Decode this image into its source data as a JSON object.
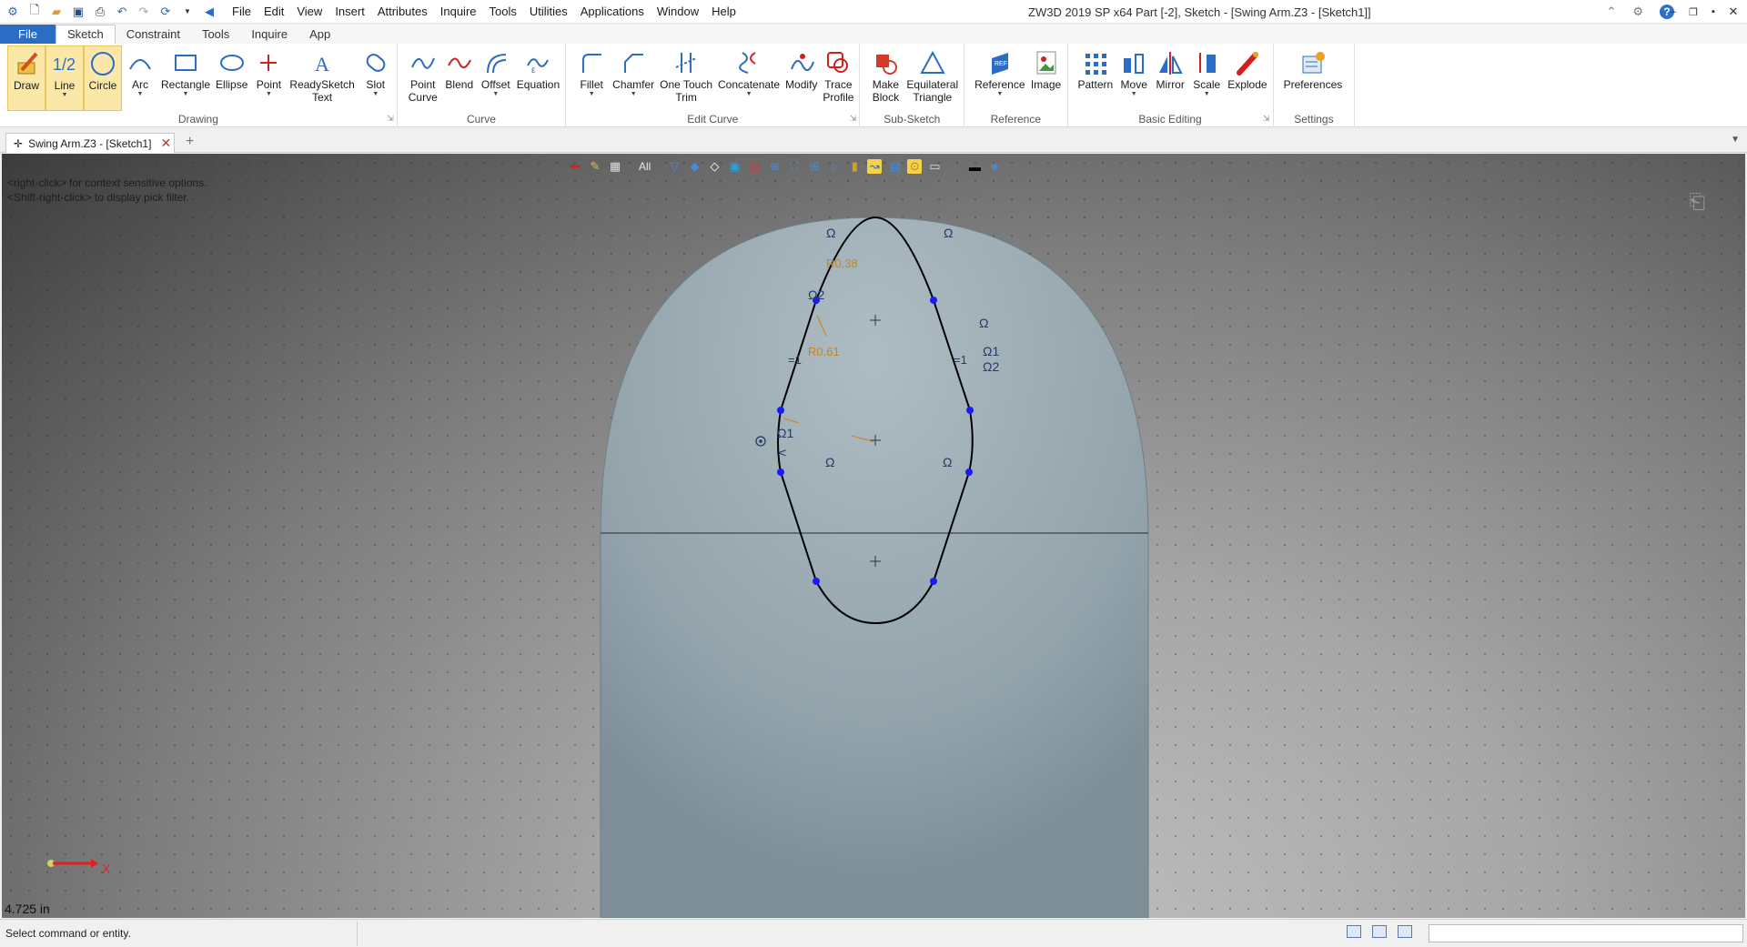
{
  "app": {
    "title": "ZW3D 2019 SP x64",
    "document_title": "Part [-2],  Sketch - [Swing Arm.Z3 - [Sketch1]]"
  },
  "quick_access": [
    "app-logo-icon",
    "new-file-icon",
    "open-file-icon",
    "save-icon",
    "print-icon",
    "undo-icon",
    "redo-icon",
    "cycle-icon",
    "dropdown-icon",
    "back-arrow-icon"
  ],
  "menubar": {
    "items": [
      "File",
      "Edit",
      "View",
      "Insert",
      "Attributes",
      "Inquire",
      "Tools",
      "Utilities",
      "Applications",
      "Window",
      "Help"
    ]
  },
  "ribbon_tabs": {
    "file": "File",
    "tabs": [
      "Sketch",
      "Constraint",
      "Tools",
      "Inquire",
      "App"
    ],
    "active": "Sketch"
  },
  "ribbon": {
    "groups": [
      {
        "title": "Drawing",
        "buttons": [
          {
            "label": "Draw",
            "icon": "pencil-icon",
            "selected": true
          },
          {
            "label": "Line",
            "icon": "line-icon",
            "selected": true,
            "dropdown": true
          },
          {
            "label": "Circle",
            "icon": "circle-icon",
            "selected": true
          },
          {
            "label": "Arc",
            "icon": "arc-icon",
            "dropdown": true
          },
          {
            "label": "Rectangle",
            "icon": "rectangle-icon",
            "dropdown": true
          },
          {
            "label": "Ellipse",
            "icon": "ellipse-icon"
          },
          {
            "label": "Point",
            "icon": "point-icon",
            "dropdown": true
          },
          {
            "label": "ReadySketch",
            "label2": "Text",
            "icon": "text-icon",
            "dropdown": true
          },
          {
            "label": "Slot",
            "icon": "slot-icon",
            "dropdown": true
          }
        ]
      },
      {
        "title": "Curve",
        "buttons": [
          {
            "label": "Point",
            "label2": "Curve",
            "icon": "point-curve-icon",
            "dropdown": true
          },
          {
            "label": "Blend",
            "icon": "blend-icon"
          },
          {
            "label": "Offset",
            "icon": "offset-icon",
            "dropdown": true
          },
          {
            "label": "Equation",
            "icon": "equation-icon"
          }
        ]
      },
      {
        "title": "Edit Curve",
        "buttons": [
          {
            "label": "Fillet",
            "icon": "fillet-icon",
            "dropdown": true
          },
          {
            "label": "Chamfer",
            "icon": "chamfer-icon",
            "dropdown": true
          },
          {
            "label": "One Touch",
            "label2": "Trim",
            "icon": "trim-icon",
            "dropdown": true
          },
          {
            "label": "Concatenate",
            "icon": "concatenate-icon",
            "dropdown": true
          },
          {
            "label": "Modify",
            "icon": "modify-icon"
          },
          {
            "label": "Trace",
            "label2": "Profile",
            "icon": "trace-profile-icon",
            "dropdown": true
          }
        ]
      },
      {
        "title": "Sub-Sketch",
        "buttons": [
          {
            "label": "Make",
            "label2": "Block",
            "icon": "make-block-icon",
            "dropdown": true
          },
          {
            "label": "Equilateral",
            "label2": "Triangle",
            "icon": "triangle-icon",
            "dropdown": true
          }
        ]
      },
      {
        "title": "Reference",
        "buttons": [
          {
            "label": "Reference",
            "icon": "reference-icon",
            "dropdown": true
          },
          {
            "label": "Image",
            "icon": "image-icon"
          }
        ]
      },
      {
        "title": "Basic Editing",
        "buttons": [
          {
            "label": "Pattern",
            "icon": "pattern-icon"
          },
          {
            "label": "Move",
            "icon": "move-icon",
            "dropdown": true
          },
          {
            "label": "Mirror",
            "icon": "mirror-icon"
          },
          {
            "label": "Scale",
            "icon": "scale-icon",
            "dropdown": true
          },
          {
            "label": "Explode",
            "icon": "explode-icon"
          }
        ]
      },
      {
        "title": "Settings",
        "buttons": [
          {
            "label": "Preferences",
            "icon": "preferences-icon"
          }
        ]
      }
    ]
  },
  "document_tabs": [
    {
      "label": "Swing Arm.Z3 - [Sketch1]",
      "active": true
    }
  ],
  "viewport": {
    "hints": [
      "<right-click> for context sensitive options.",
      "<Shift-right-click> to display pick filter."
    ],
    "filter_label": "All",
    "scale_readout": "4.725 in",
    "axis_label": "X",
    "dimensions": [
      "R0.38",
      "R0.61"
    ],
    "constraint_symbols": [
      "Ω",
      "Ω",
      "Ω2",
      "Ω",
      "Ω1",
      "Ω2",
      "Ω1",
      "Ω",
      "Ω",
      "=1",
      "=1"
    ]
  },
  "statusbar": {
    "text": "Select command or entity."
  },
  "colors": {
    "file_tab": "#2b6cc4",
    "selected_tool": "#fbe8a8",
    "sketch_point": "#1a1aff",
    "dimension": "#c8861a",
    "profile": "#000000",
    "body": "#93a3ab"
  }
}
